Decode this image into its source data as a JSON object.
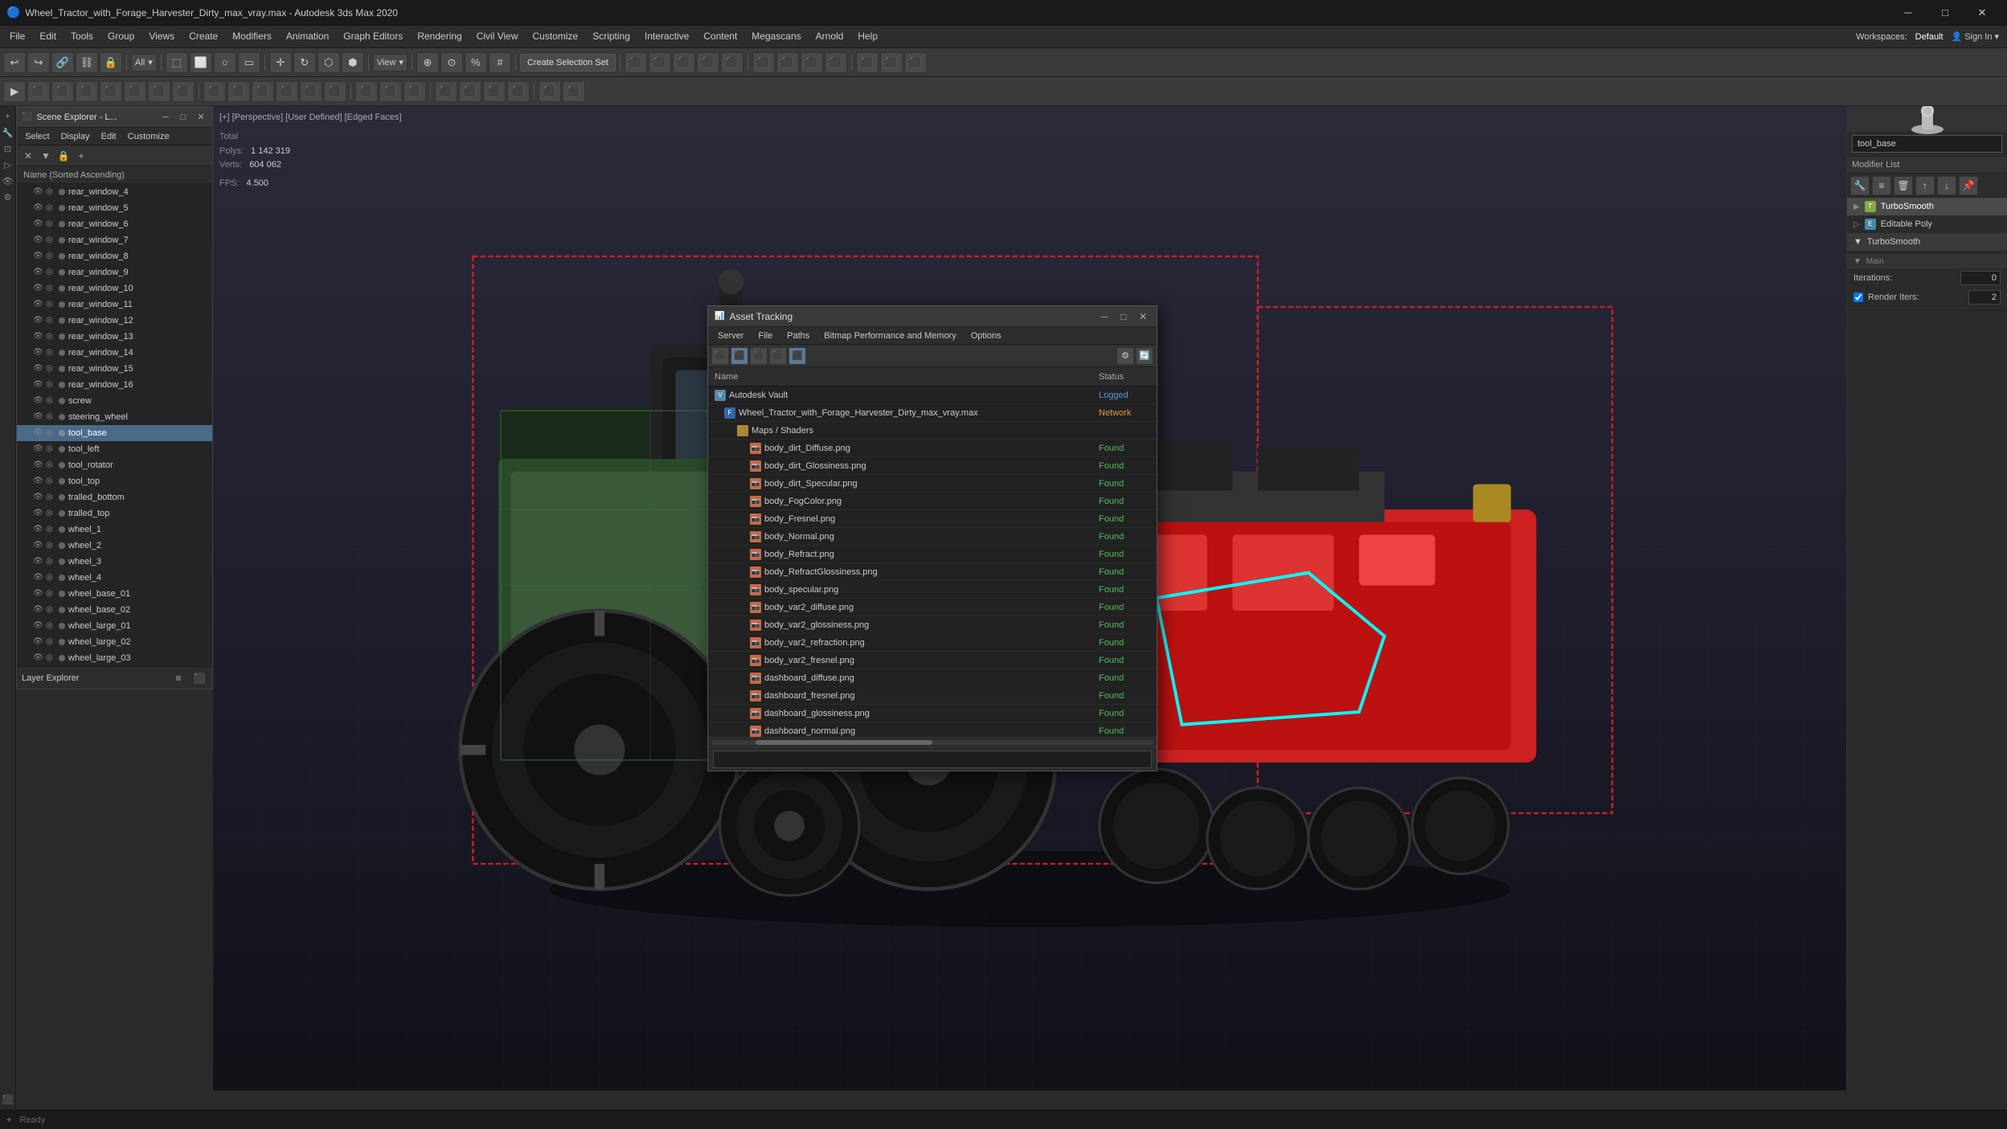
{
  "titleBar": {
    "title": "Wheel_Tractor_with_Forage_Harvester_Dirty_max_vray.max - Autodesk 3ds Max 2020",
    "minimize": "─",
    "maximize": "□",
    "close": "✕"
  },
  "menuBar": {
    "items": [
      "File",
      "Edit",
      "Tools",
      "Group",
      "Views",
      "Create",
      "Modifiers",
      "Animation",
      "Graph Editors",
      "Rendering",
      "Civil View",
      "Customize",
      "Scripting",
      "Interactive",
      "Content",
      "Megascans",
      "Arnold",
      "Help"
    ]
  },
  "toolbar1": {
    "createSelectionSet": "Create Selection Set",
    "viewMode": "View",
    "selectionMode": "All"
  },
  "viewportLabel": "[+] [Perspective] [User Defined] [Edged Faces]",
  "stats": {
    "polys_label": "Polys:",
    "polys_total": "1 142 319",
    "verts_label": "Verts:",
    "verts_total": "604 062",
    "fps_label": "FPS:",
    "fps_value": "4.500",
    "total_label": "Total"
  },
  "sceneExplorer": {
    "title": "Scene Explorer - L...",
    "menus": [
      "Select",
      "Display",
      "Edit",
      "Customize"
    ],
    "columnHeader": "Name (Sorted Ascending)",
    "items": [
      {
        "name": "rear_window_4",
        "selected": false
      },
      {
        "name": "rear_window_5",
        "selected": false
      },
      {
        "name": "rear_window_6",
        "selected": false
      },
      {
        "name": "rear_window_7",
        "selected": false
      },
      {
        "name": "rear_window_8",
        "selected": false
      },
      {
        "name": "rear_window_9",
        "selected": false
      },
      {
        "name": "rear_window_10",
        "selected": false
      },
      {
        "name": "rear_window_11",
        "selected": false
      },
      {
        "name": "rear_window_12",
        "selected": false
      },
      {
        "name": "rear_window_13",
        "selected": false
      },
      {
        "name": "rear_window_14",
        "selected": false
      },
      {
        "name": "rear_window_15",
        "selected": false
      },
      {
        "name": "rear_window_16",
        "selected": false
      },
      {
        "name": "screw",
        "selected": false
      },
      {
        "name": "steering_wheel",
        "selected": false
      },
      {
        "name": "tool_base",
        "selected": true
      },
      {
        "name": "tool_left",
        "selected": false
      },
      {
        "name": "tool_rotator",
        "selected": false
      },
      {
        "name": "tool_top",
        "selected": false
      },
      {
        "name": "tralled_bottom",
        "selected": false
      },
      {
        "name": "tralled_top",
        "selected": false
      },
      {
        "name": "wheel_1",
        "selected": false
      },
      {
        "name": "wheel_2",
        "selected": false
      },
      {
        "name": "wheel_3",
        "selected": false
      },
      {
        "name": "wheel_4",
        "selected": false
      },
      {
        "name": "wheel_base_01",
        "selected": false
      },
      {
        "name": "wheel_base_02",
        "selected": false
      },
      {
        "name": "wheel_large_01",
        "selected": false
      },
      {
        "name": "wheel_large_02",
        "selected": false
      },
      {
        "name": "wheel_large_03",
        "selected": false
      }
    ]
  },
  "layerExplorer": {
    "label": "Layer Explorer"
  },
  "rightPanel": {
    "inputValue": "tool_base",
    "modifierListLabel": "Modifier List",
    "modifiers": [
      {
        "name": "TurboSmooth",
        "active": true
      },
      {
        "name": "Editable Poly",
        "active": false
      }
    ],
    "turboSmooth": {
      "title": "TurboSmooth",
      "mainLabel": "Main",
      "iterationsLabel": "Iterations:",
      "iterationsValue": "0",
      "renderItersLabel": "Render Iters:",
      "renderItersValue": "2",
      "renderItersChecked": true
    }
  },
  "assetTracking": {
    "title": "Asset Tracking",
    "menus": [
      "Server",
      "File",
      "Paths",
      "Bitmap Performance and Memory",
      "Options"
    ],
    "columns": {
      "name": "Name",
      "status": "Status"
    },
    "tree": [
      {
        "indent": 0,
        "name": "Autodesk Vault",
        "status": "Logged",
        "type": "root",
        "icon": "vault"
      },
      {
        "indent": 1,
        "name": "Wheel_Tractor_with_Forage_Harvester_Dirty_max_vray.max",
        "status": "Network",
        "type": "file",
        "icon": "file"
      },
      {
        "indent": 2,
        "name": "Maps / Shaders",
        "status": "",
        "type": "folder",
        "icon": "folder"
      },
      {
        "indent": 3,
        "name": "body_dirt_Diffuse.png",
        "status": "Found",
        "type": "file",
        "icon": "image"
      },
      {
        "indent": 3,
        "name": "body_dirt_Glossiness.png",
        "status": "Found",
        "type": "file",
        "icon": "image"
      },
      {
        "indent": 3,
        "name": "body_dirt_Specular.png",
        "status": "Found",
        "type": "file",
        "icon": "image"
      },
      {
        "indent": 3,
        "name": "body_FogColor.png",
        "status": "Found",
        "type": "file",
        "icon": "image"
      },
      {
        "indent": 3,
        "name": "body_Fresnel.png",
        "status": "Found",
        "type": "file",
        "icon": "image"
      },
      {
        "indent": 3,
        "name": "body_Normal.png",
        "status": "Found",
        "type": "file",
        "icon": "image"
      },
      {
        "indent": 3,
        "name": "body_Refract.png",
        "status": "Found",
        "type": "file",
        "icon": "image"
      },
      {
        "indent": 3,
        "name": "body_RefractGlossiness.png",
        "status": "Found",
        "type": "file",
        "icon": "image"
      },
      {
        "indent": 3,
        "name": "body_specular.png",
        "status": "Found",
        "type": "file",
        "icon": "image"
      },
      {
        "indent": 3,
        "name": "body_var2_diffuse.png",
        "status": "Found",
        "type": "file",
        "icon": "image"
      },
      {
        "indent": 3,
        "name": "body_var2_glossiness.png",
        "status": "Found",
        "type": "file",
        "icon": "image"
      },
      {
        "indent": 3,
        "name": "body_var2_refraction.png",
        "status": "Found",
        "type": "file",
        "icon": "image"
      },
      {
        "indent": 3,
        "name": "body_var2_fresnel.png",
        "status": "Found",
        "type": "file",
        "icon": "image"
      },
      {
        "indent": 3,
        "name": "dashboard_diffuse.png",
        "status": "Found",
        "type": "file",
        "icon": "image"
      },
      {
        "indent": 3,
        "name": "dashboard_fresnel.png",
        "status": "Found",
        "type": "file",
        "icon": "image"
      },
      {
        "indent": 3,
        "name": "dashboard_glossiness.png",
        "status": "Found",
        "type": "file",
        "icon": "image"
      },
      {
        "indent": 3,
        "name": "dashboard_normal.png",
        "status": "Found",
        "type": "file",
        "icon": "image"
      }
    ]
  },
  "workspaces": {
    "label": "Workspaces:",
    "value": "Default"
  },
  "signIn": {
    "label": "Sign In",
    "arrow": "▾"
  },
  "statusBar": {
    "addItem": "+"
  }
}
